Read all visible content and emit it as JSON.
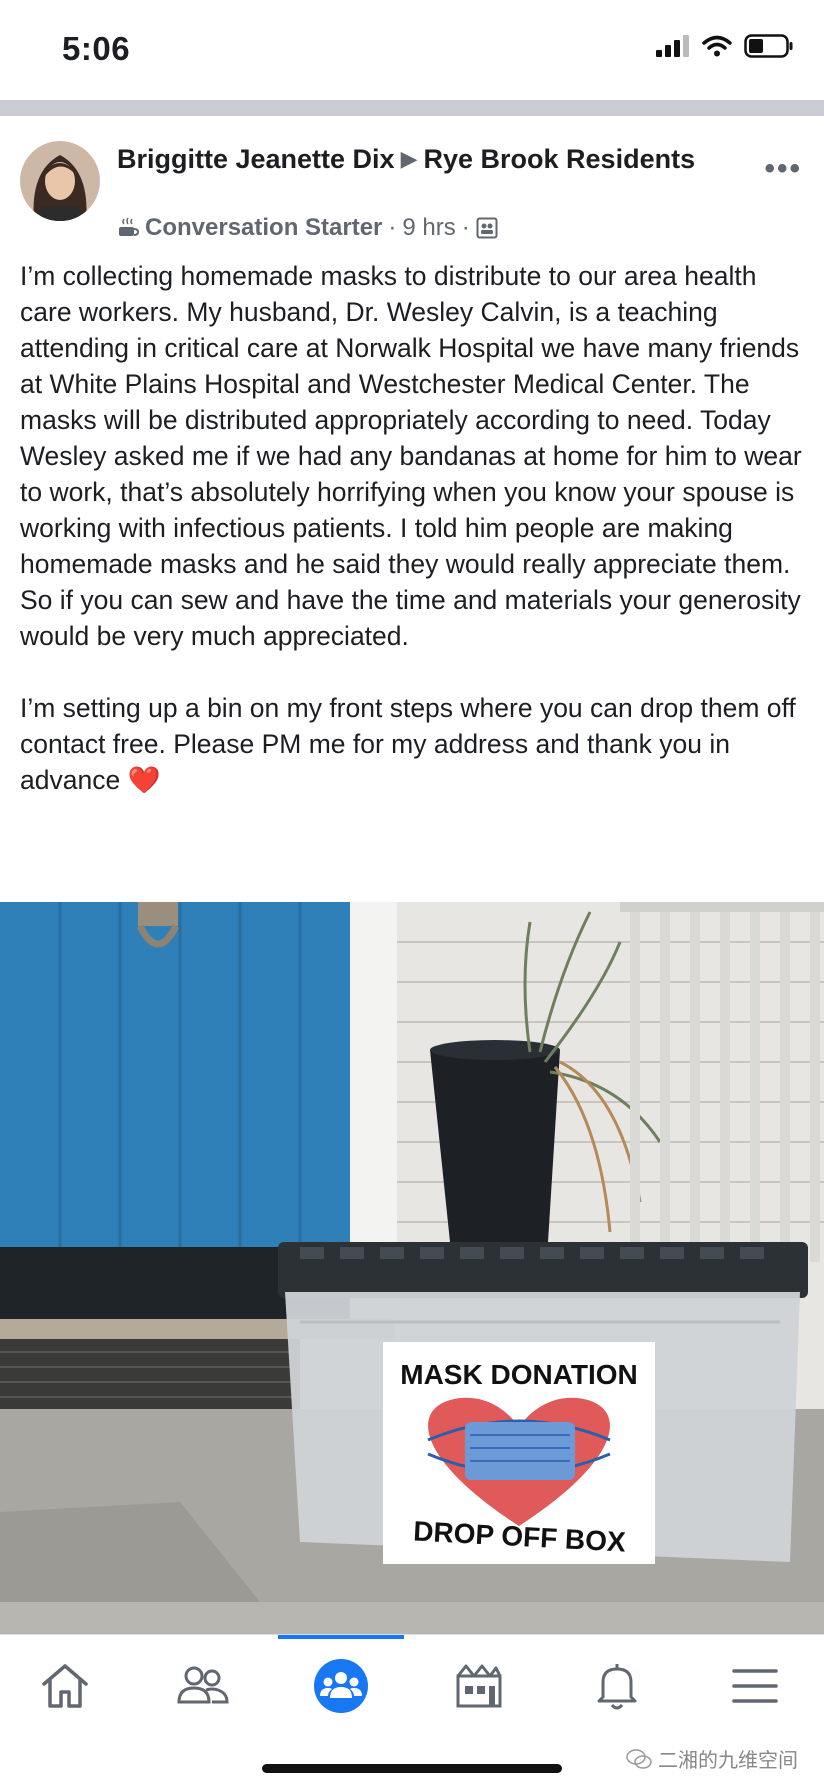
{
  "status_bar": {
    "time": "5:06"
  },
  "post": {
    "author": "Briggitte Jeanette Dix",
    "group": "Rye Brook Residents",
    "badge": "Conversation Starter",
    "time": "9 hrs",
    "more_label": "•••",
    "body": "I’m collecting homemade masks to distribute to our area health care workers. My husband, Dr. Wesley Calvin, is a teaching attending in critical care at Norwalk Hospital we have many friends at White Plains Hospital and Westchester Medical Center. The masks will be distributed appropriately according to need. Today Wesley asked me if we had any bandanas at home for him to wear to work, that’s absolutely horrifying when you know your spouse is working with infectious patients. I told him people are making homemade masks and he said they would really appreciate them. So if you can sew and have the time and materials your generosity would be very much appreciated.\n\nI’m setting up a bin on my front steps where you can drop them off contact free. Please PM me for my address and thank you in advance ❤️"
  },
  "photo_sign": {
    "top_text": "MASK DONATION",
    "bottom_text": "DROP OFF BOX"
  },
  "tab_bar": {
    "items": [
      "home-icon",
      "friends-icon",
      "groups-icon",
      "marketplace-icon",
      "notifications-icon",
      "menu-icon"
    ],
    "active_index": 2
  },
  "watermark": {
    "text": "二湘的九维空间"
  },
  "colors": {
    "accent": "#1877f2",
    "door": "#2f7fb8",
    "heart": "#e05a5a"
  }
}
